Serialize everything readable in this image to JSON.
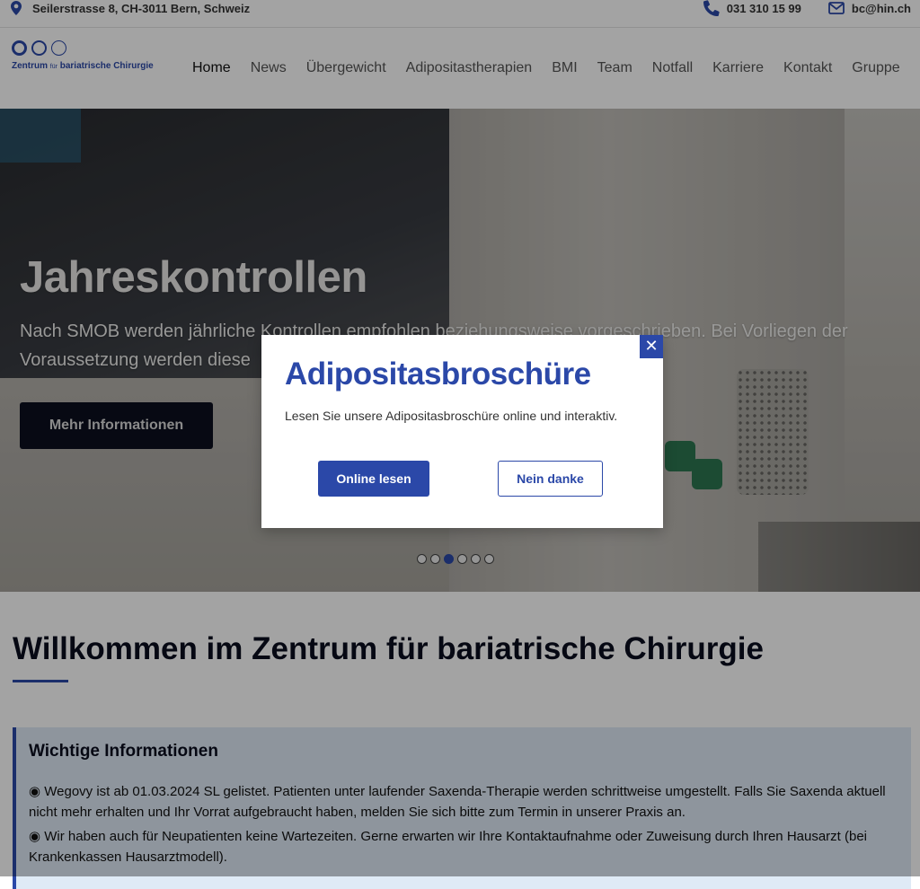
{
  "topbar": {
    "address": "Seilerstrasse 8, CH-3011 Bern, Schweiz",
    "address_icon": "map-pin-icon",
    "phone": "031 310 15 99",
    "phone_icon": "phone-icon",
    "email": "bc@hin.ch",
    "email_icon": "envelope-icon"
  },
  "logo": {
    "text_main_1": "Zentrum",
    "text_small": "für",
    "text_main_2": "bariatrische Chirurgie",
    "brand_color": "#2b48a8"
  },
  "nav": {
    "items": [
      "Home",
      "News",
      "Übergewicht",
      "Adipositastherapien",
      "BMI",
      "Team",
      "Notfall",
      "Karriere",
      "Kontakt",
      "Gruppe"
    ],
    "active": "Home"
  },
  "hero": {
    "title": "Jahreskontrollen",
    "text": "Nach SMOB werden jährliche Kontrollen empfohlen beziehungsweise vorgeschrieben. Bei Vorliegen der Voraussetzung werden diese",
    "button": "Mehr Informationen",
    "slides_count": 6,
    "active_slide": 3
  },
  "welcome": {
    "title": "Willkommen im Zentrum für bariatrische Chirurgie"
  },
  "info": {
    "title": "Wichtige Informationen",
    "paragraphs": [
      "◉ Wegovy ist ab 01.03.2024 SL gelistet. Patienten unter laufender Saxenda-Therapie werden schrittweise umgestellt. Falls Sie Saxenda aktuell nicht mehr erhalten und Ihr Vorrat aufgebraucht haben, melden Sie sich bitte zum Termin in unserer Praxis an.",
      "◉ Wir haben auch für Neupatienten keine Wartezeiten. Gerne erwarten wir Ihre Kontaktaufnahme oder Zuweisung durch Ihren Hausarzt (bei Krankenkassen Hausarztmodell)."
    ]
  },
  "modal": {
    "title": "Adipositasbroschüre",
    "text": "Lesen Sie unsere Adipositasbroschüre online und interaktiv.",
    "primary_button": "Online lesen",
    "secondary_button": "Nein danke",
    "close_label": "✕",
    "close_icon": "close-icon"
  }
}
